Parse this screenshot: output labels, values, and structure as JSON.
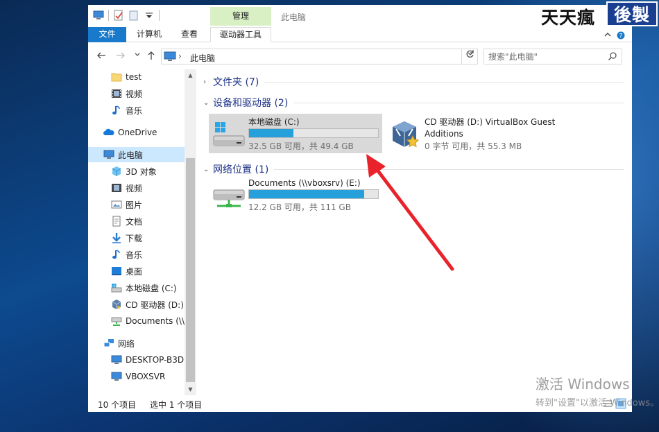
{
  "window": {
    "title": "此电脑",
    "context_tab": "管理"
  },
  "ribbon": {
    "tabs": [
      {
        "label": "文件"
      },
      {
        "label": "计算机"
      },
      {
        "label": "查看"
      },
      {
        "label": "驱动器工具"
      }
    ]
  },
  "address": {
    "path": "此电脑",
    "search_placeholder": "搜索\"此电脑\""
  },
  "sidebar": {
    "items": [
      {
        "label": "test",
        "icon": "folder-icon"
      },
      {
        "label": "视频",
        "icon": "video-icon"
      },
      {
        "label": "音乐",
        "icon": "music-icon"
      },
      {
        "label": "OneDrive",
        "icon": "cloud-icon"
      },
      {
        "label": "此电脑",
        "icon": "computer-icon",
        "selected": true
      },
      {
        "label": "3D 对象",
        "icon": "cube-icon"
      },
      {
        "label": "视频",
        "icon": "video-icon"
      },
      {
        "label": "图片",
        "icon": "picture-icon"
      },
      {
        "label": "文档",
        "icon": "document-icon"
      },
      {
        "label": "下载",
        "icon": "download-icon"
      },
      {
        "label": "音乐",
        "icon": "music-icon"
      },
      {
        "label": "桌面",
        "icon": "desktop-icon"
      },
      {
        "label": "本地磁盘 (C:)",
        "icon": "drive-icon"
      },
      {
        "label": "CD 驱动器 (D:) ",
        "icon": "cd-drive-icon"
      },
      {
        "label": "Documents (\\\\",
        "icon": "network-drive-icon"
      },
      {
        "label": "网络",
        "icon": "network-icon"
      },
      {
        "label": "DESKTOP-B3DI",
        "icon": "monitor-icon"
      },
      {
        "label": "VBOXSVR",
        "icon": "monitor-icon"
      }
    ]
  },
  "content": {
    "groups": [
      {
        "label": "文件夹 (7)"
      },
      {
        "label": "设备和驱动器 (2)"
      },
      {
        "label": "网络位置 (1)"
      }
    ],
    "drives": [
      {
        "label": "本地磁盘 (C:)",
        "sub": "32.5 GB 可用，共 49.4 GB",
        "used_fraction": 0.342,
        "selected": true
      },
      {
        "label_line1": "CD 驱动器 (D:) VirtualBox Guest",
        "label_line2": "Additions",
        "sub": "0 字节 可用，共 55.3 MB"
      },
      {
        "label": "Documents (\\\\vboxsrv) (E:)",
        "sub": "12.2 GB 可用，共 111 GB",
        "used_fraction": 0.89
      }
    ]
  },
  "status": {
    "count": "10 个项目",
    "selection": "选中 1 个项目"
  },
  "watermark": {
    "text1": "天天瘋",
    "text2": "後製"
  },
  "activation": {
    "line1": "激活 Windows",
    "line2": "转到\"设置\"以激活 Windows。"
  },
  "colors": {
    "accent": "#1979ca",
    "bar_fill": "#26a0da",
    "context_tab": "#d8f0c3",
    "selection": "#cce8ff",
    "group_header": "#1e3287",
    "arrow": "#e8232b"
  }
}
